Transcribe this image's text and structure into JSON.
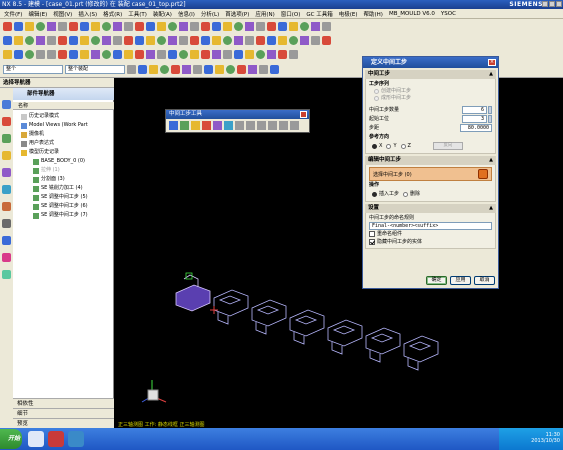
{
  "window": {
    "title": "NX 8.5 - 建模 - [case_01.prt (修改的) 在 装配 case_01_top.prt2]",
    "brand": "SIEMENS"
  },
  "menubar": {
    "items": [
      "文件(F)",
      "编辑(E)",
      "视图(V)",
      "插入(S)",
      "格式(R)",
      "工具(T)",
      "装配(A)",
      "信息(I)",
      "分析(L)",
      "首选项(P)",
      "应用(N)",
      "窗口(O)",
      "GC 工具箱",
      "电极(E)",
      "帮助(H)",
      "MB_MOULD V6.0",
      "YSOC"
    ]
  },
  "filterbar": {
    "type_filter": "整个",
    "scope_filter": "整个装配"
  },
  "navigator": {
    "app_label": "选择导航器",
    "panel_title": "部件导航器",
    "column_name": "名称",
    "items": [
      "历史记录模式",
      "Model Views (Work Part",
      "摄像机",
      "用户表达式",
      "模型历史记录",
      "BASE_BODY_0 (0)",
      "拉伸 (1)",
      "分割面 (3)",
      "SE 铣削力加工 (4)",
      "SE 调整中间工步 (5)",
      "SE 调整中间工步 (6)",
      "SE 调整中间工步 (7)"
    ],
    "bottom_panels": [
      "相依性",
      "细节",
      "预览"
    ]
  },
  "floating_toolbar": {
    "title": "中间工步工具"
  },
  "dialog": {
    "title": "定义中间工步",
    "section_step": {
      "head": "中间工步",
      "subhead": "工步序列",
      "opt1": "创建中间工步",
      "opt2": "成形中间工步",
      "count_label": "中间工步数量",
      "count_value": "6",
      "start_label": "起始工位",
      "start_value": "3",
      "step_label": "步距",
      "step_value": "80.0000",
      "dir_label": "参考方向",
      "dir_x": "X",
      "dir_y": "Y",
      "dir_z": "Z",
      "dir_button": "反向"
    },
    "section_edit": {
      "head": "编辑中间工步",
      "select_label": "选择中间工步 (0)",
      "op_label": "操作",
      "op_create": "插入工步",
      "op_delete": "删除"
    },
    "section_settings": {
      "head": "设置",
      "name_rule_label": "中间工步的命名规则",
      "name_rule_value": "Final-<number><suffix>",
      "check1": "重命名组件",
      "check2": "隐藏中间工步的实体"
    },
    "buttons": {
      "ok": "确定",
      "apply": "应用",
      "cancel": "取消"
    }
  },
  "viewport": {
    "status": "正三轴测图 工作: 静态线框 正三轴测图"
  },
  "taskbar": {
    "start": "开始",
    "time": "11:30",
    "date": "2013/10/30"
  }
}
